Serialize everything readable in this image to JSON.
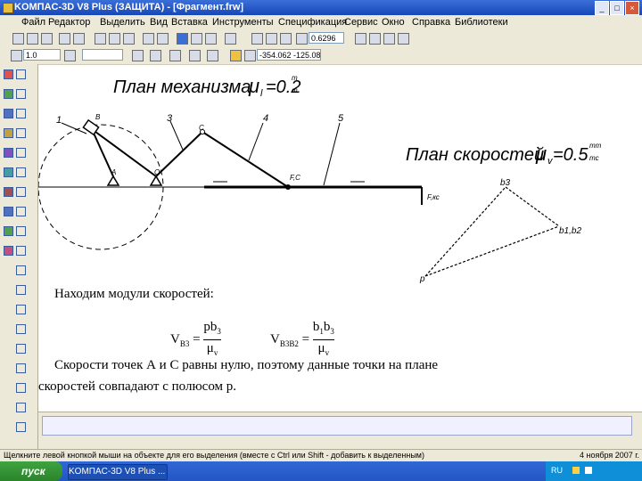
{
  "window": {
    "title": "KOMПAC-3D V8 Plus (ЗАЩИТА) - [Фрагмент.frw]",
    "min": "_",
    "max": "□",
    "close": "×"
  },
  "menu": [
    "Файл",
    "Редактор",
    "Выделить",
    "Вид",
    "Вставка",
    "Инструменты",
    "Спецификация",
    "Сервис",
    "Окно",
    "Справка",
    "Библиотеки"
  ],
  "toolbar": {
    "scale_value": "0.6296",
    "layer_value": "1.0",
    "coords_value": "-354.062  -125.08"
  },
  "drawing": {
    "mechanism_title": "План механизма",
    "mechanism_mu": "μ",
    "mechanism_mu_sub": "l",
    "mechanism_mu_value": "=0.2",
    "mechanism_units_num": "m",
    "mechanism_units_den": "m",
    "velocity_title": "План скоростей",
    "velocity_mu": "μ",
    "velocity_mu_sub": "v",
    "velocity_mu_value": "=0.5",
    "velocity_units_num": "mm",
    "velocity_units_den": "mc",
    "link_labels": [
      "1",
      "3",
      "4",
      "5"
    ],
    "point_labels": {
      "b": "B",
      "c": "C",
      "a": "A",
      "o": "O",
      "f": "F,C",
      "fvec": "F,кс",
      "b3": "b3",
      "b1b2": "b1,b2",
      "p": "p"
    }
  },
  "text": {
    "line1": "Находим модули скоростей:",
    "v1_label": "V",
    "v1_sub": "B3",
    "v1_num": "pb",
    "v1_num_sub": "3",
    "v1_den": "μ",
    "v1_den_sub": "v",
    "v2_label": "V",
    "v2_sub": "B3B2",
    "v2_num": "b",
    "v2_num_sub1": "1",
    "v2_num_mid": "b",
    "v2_num_sub2": "3",
    "v2_den": "μ",
    "v2_den_sub": "v",
    "eq": "=",
    "para1": "Скорости  точек  А  и  С  равны  нулю,  поэтому  данные  точки  на  плане",
    "para2": "скоростей совпадают с полюсом р."
  },
  "status": {
    "hint": "Щелкните левой кнопкой мыши на объекте для его выделения (вместе с Ctrl или Shift - добавить к выделенным)",
    "date": "4 ноября 2007 г."
  },
  "taskbar": {
    "start_label": "пуск",
    "app_button": "KOMПAC-3D V8 Plus ...",
    "lang": "RU"
  }
}
